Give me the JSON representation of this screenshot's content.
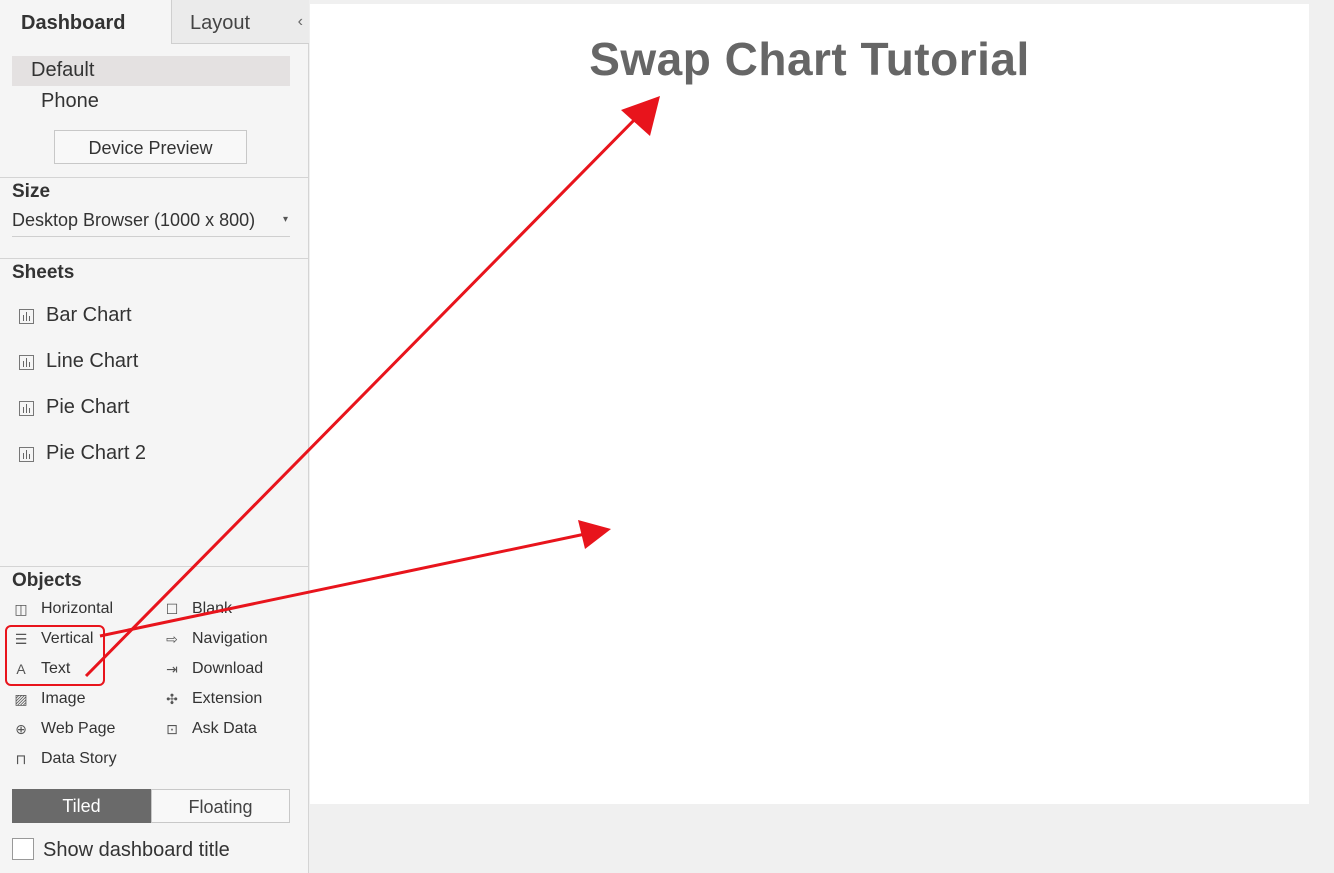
{
  "left_panel": {
    "tabs": {
      "dashboard": "Dashboard",
      "layout": "Layout",
      "collapse_glyph": "‹"
    },
    "device": {
      "default": "Default",
      "phone": "Phone",
      "preview_button": "Device Preview"
    },
    "size": {
      "heading": "Size",
      "value": "Desktop Browser (1000 x 800)",
      "caret": "▾"
    },
    "sheets": {
      "heading": "Sheets",
      "items": [
        "Bar Chart",
        "Line Chart",
        "Pie Chart",
        "Pie Chart 2"
      ]
    },
    "objects": {
      "heading": "Objects",
      "items": [
        {
          "label": "Horizontal",
          "icon": "horizontal-container-icon",
          "glyph": "◫"
        },
        {
          "label": "Blank",
          "icon": "blank-icon",
          "glyph": "☐"
        },
        {
          "label": "Vertical",
          "icon": "vertical-container-icon",
          "glyph": "☰"
        },
        {
          "label": "Navigation",
          "icon": "navigation-icon",
          "glyph": "⇨"
        },
        {
          "label": "Text",
          "icon": "text-icon",
          "glyph": "A"
        },
        {
          "label": "Download",
          "icon": "download-icon",
          "glyph": "⇥"
        },
        {
          "label": "Image",
          "icon": "image-icon",
          "glyph": "▨"
        },
        {
          "label": "Extension",
          "icon": "extension-icon",
          "glyph": "✣"
        },
        {
          "label": "Web Page",
          "icon": "web-page-icon",
          "glyph": "⊕"
        },
        {
          "label": "Ask Data",
          "icon": "ask-data-icon",
          "glyph": "⊡"
        },
        {
          "label": "Data Story",
          "icon": "data-story-icon",
          "glyph": "⊓"
        }
      ]
    },
    "layout_mode": {
      "tiled": "Tiled",
      "floating": "Floating",
      "selected": "Tiled"
    },
    "show_title": {
      "label": "Show dashboard title",
      "checked": false
    }
  },
  "canvas": {
    "title": "Swap Chart Tutorial"
  },
  "annotation": {
    "color": "#e8141c"
  }
}
